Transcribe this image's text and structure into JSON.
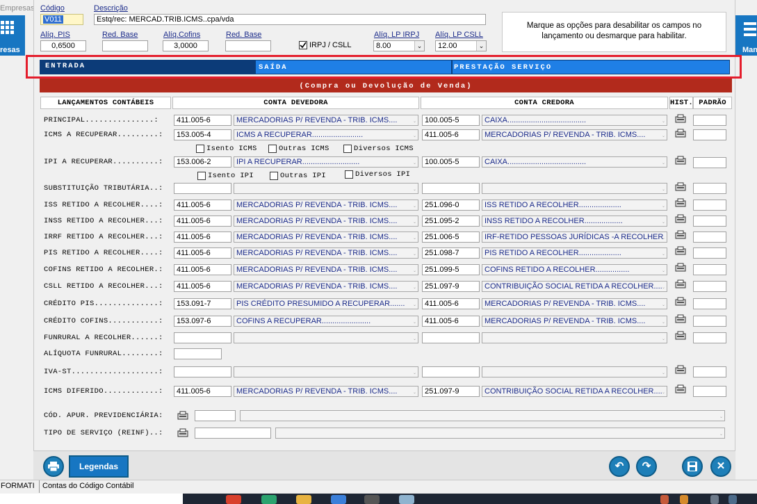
{
  "header": {
    "empresas_label": "Empresas",
    "empresas_side": "resas",
    "manifest_side": "Manife",
    "codigo_label": "Código",
    "codigo_value": "V011",
    "descricao_label": "Descrição",
    "descricao_value": "Estq/rec: MERCAD.TRIB.ICMS..cpa/vda",
    "aliq_pis_label": "Alíq. PIS",
    "aliq_pis_value": "0,6500",
    "red_base_label": "Red. Base",
    "red_base_value": "",
    "aliq_cofins_label": "Alíq.Cofins",
    "aliq_cofins_value": "3,0000",
    "red_base2_label": "Red. Base",
    "red_base2_value": "",
    "irpj_csll_label": "IRPJ / CSLL",
    "aliq_lp_irpj_label": "Alíq. LP IRPJ",
    "aliq_lp_irpj_value": "8.00",
    "aliq_lp_csll_label": "Alíq. LP CSLL",
    "aliq_lp_csll_value": "12.00",
    "info_box_text": "Marque as opções para desabilitar os campos no lançamento ou desmarque para habilitar."
  },
  "tabs": {
    "entrada": "ENTRADA",
    "saida": "SAÍDA",
    "prestacao": "PRESTAÇÃO SERVIÇO"
  },
  "banner": "(Compra ou Devolução de Venda)",
  "columns": {
    "lancamentos": "LANÇAMENTOS CONTÁBEIS",
    "devedora": "CONTA DEVEDORA",
    "credora": "CONTA CREDORA",
    "hist": "HIST.",
    "padrao": "PADRÃO"
  },
  "rows": {
    "principal": {
      "label": "PRINCIPAL...............:",
      "dev_code": "411.005-6",
      "dev_desc": "MERCADORIAS P/ REVENDA - TRIB. ICMS....",
      "cred_code": "100.005-5",
      "cred_desc": "CAIXA....................................."
    },
    "icms": {
      "label": "ICMS A RECUPERAR.........:",
      "dev_code": "153.005-4",
      "dev_desc": "ICMS A RECUPERAR........................",
      "cred_code": "411.005-6",
      "cred_desc": "MERCADORIAS P/ REVENDA - TRIB. ICMS...."
    },
    "ipi": {
      "label": "IPI A RECUPERAR..........:",
      "dev_code": "153.006-2",
      "dev_desc": "IPI A RECUPERAR...........................",
      "cred_code": "100.005-5",
      "cred_desc": "CAIXA....................................."
    },
    "subst": {
      "label": "SUBSTITUIÇÃO TRIBUTÁRIA..:",
      "dev_code": "",
      "dev_desc": "",
      "cred_code": "",
      "cred_desc": ""
    },
    "iss": {
      "label": "ISS RETIDO A RECOLHER....:",
      "dev_code": "411.005-6",
      "dev_desc": "MERCADORIAS P/ REVENDA - TRIB. ICMS....",
      "cred_code": "251.096-0",
      "cred_desc": "ISS RETIDO A RECOLHER...................."
    },
    "inss": {
      "label": "INSS RETIDO A RECOLHER...:",
      "dev_code": "411.005-6",
      "dev_desc": "MERCADORIAS P/ REVENDA - TRIB. ICMS....",
      "cred_code": "251.095-2",
      "cred_desc": "INSS RETIDO A RECOLHER.................."
    },
    "irrf": {
      "label": "IRRF RETIDO A RECOLHER...:",
      "dev_code": "411.005-6",
      "dev_desc": "MERCADORIAS P/ REVENDA - TRIB. ICMS....",
      "cred_code": "251.006-5",
      "cred_desc": "IRF-RETIDO PESSOAS JURÍDICAS -A RECOLHER"
    },
    "pis": {
      "label": "PIS RETIDO A RECOLHER....:",
      "dev_code": "411.005-6",
      "dev_desc": "MERCADORIAS P/ REVENDA - TRIB. ICMS....",
      "cred_code": "251.098-7",
      "cred_desc": "PIS RETIDO A RECOLHER...................."
    },
    "cofins": {
      "label": "COFINS RETIDO A RECOLHER.:",
      "dev_code": "411.005-6",
      "dev_desc": "MERCADORIAS P/ REVENDA - TRIB. ICMS....",
      "cred_code": "251.099-5",
      "cred_desc": "COFINS RETIDO A RECOLHER................"
    },
    "csll": {
      "label": "CSLL RETIDO A RECOLHER...:",
      "dev_code": "411.005-6",
      "dev_desc": "MERCADORIAS P/ REVENDA - TRIB. ICMS....",
      "cred_code": "251.097-9",
      "cred_desc": "CONTRIBUIÇÃO SOCIAL RETIDA A RECOLHER...."
    },
    "credpis": {
      "label": "CRÉDITO PIS..............:",
      "dev_code": "153.091-7",
      "dev_desc": "PIS CRÉDITO PRESUMIDO A RECUPERAR.......",
      "cred_code": "411.005-6",
      "cred_desc": "MERCADORIAS P/ REVENDA - TRIB. ICMS...."
    },
    "credcofins": {
      "label": "CRÉDITO COFINS...........:",
      "dev_code": "153.097-6",
      "dev_desc": "COFINS A RECUPERAR.......................",
      "cred_code": "411.005-6",
      "cred_desc": "MERCADORIAS P/ REVENDA - TRIB. ICMS...."
    },
    "funrural": {
      "label": "FUNRURAL A RECOLHER......:",
      "dev_code": "",
      "dev_desc": "",
      "cred_code": "",
      "cred_desc": ""
    },
    "aliqfunrural": {
      "label": "ALÍQUOTA FUNRURAL........:",
      "value": ""
    },
    "ivast": {
      "label": "IVA-ST...................:",
      "dev_code": "",
      "dev_desc": "",
      "cred_code": "",
      "cred_desc": ""
    },
    "icmsdif": {
      "label": "ICMS DIFERIDO............:",
      "dev_code": "411.005-6",
      "dev_desc": "MERCADORIAS P/ REVENDA - TRIB. ICMS....",
      "cred_code": "251.097-9",
      "cred_desc": "CONTRIBUIÇÃO SOCIAL RETIDA A RECOLHER...."
    },
    "codapur": {
      "label": "CÓD. APUR. PREVIDENCIÁRIA:",
      "code": "",
      "desc": ""
    },
    "tiposerv": {
      "label": "TIPO DE SERVIÇO (REINF)..:",
      "code": "",
      "desc": ""
    }
  },
  "checks": {
    "isento_icms": "Isento ICMS",
    "outras_icms": "Outras ICMS",
    "diversos_icms": "Diversos ICMS",
    "isento_ipi": "Isento IPI",
    "outras_ipi": "Outras IPI",
    "diversos_ipi": "Diversos IPI"
  },
  "footer": {
    "legendas_label": "Legendas",
    "status_left": "FORMATI",
    "status_text": "Contas do Código Contábil"
  },
  "colors": {
    "tab_entrada": "#0c3b78",
    "tab_active": "#1f7fe6",
    "banner": "#b22a1c",
    "highlight": "#e41d2c",
    "side_panel": "#1776c2"
  }
}
